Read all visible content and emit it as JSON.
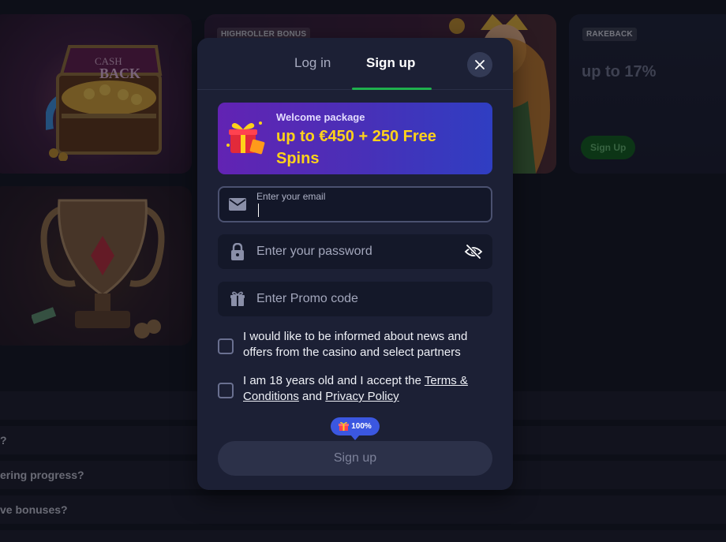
{
  "background": {
    "highroller_tag": "HIGHROLLER BONUS",
    "rakeback_tag": "RAKEBACK",
    "rakeback_title": "up to 17%",
    "rakeback_button": "Sign Up",
    "cashback_art_text_1": "CASH",
    "cashback_art_text_2": "BACK",
    "faq": [
      "?",
      "ering progress?",
      "ve bonuses?"
    ]
  },
  "modal": {
    "tabs": {
      "login": "Log in",
      "signup": "Sign up"
    },
    "promo": {
      "subtitle": "Welcome package",
      "title": "up to €450 + 250 Free Spins"
    },
    "email": {
      "label": "Enter your email",
      "value": ""
    },
    "password": {
      "placeholder": "Enter your password"
    },
    "promo_code": {
      "placeholder": "Enter Promo code"
    },
    "checkbox_news": {
      "text": "I would like to be informed about news and offers from the casino and select partners",
      "checked": false
    },
    "checkbox_age": {
      "text_before": "I am 18 years old and I accept the ",
      "terms_link": "Terms & Conditions",
      "text_and": " and ",
      "privacy_link": "Privacy Policy",
      "checked": false
    },
    "progress_badge": "100%",
    "submit_label": "Sign up"
  },
  "colors": {
    "accent_green": "#1fb04d",
    "promo_yellow": "#ffd21a",
    "badge_blue": "#3b57e0"
  }
}
